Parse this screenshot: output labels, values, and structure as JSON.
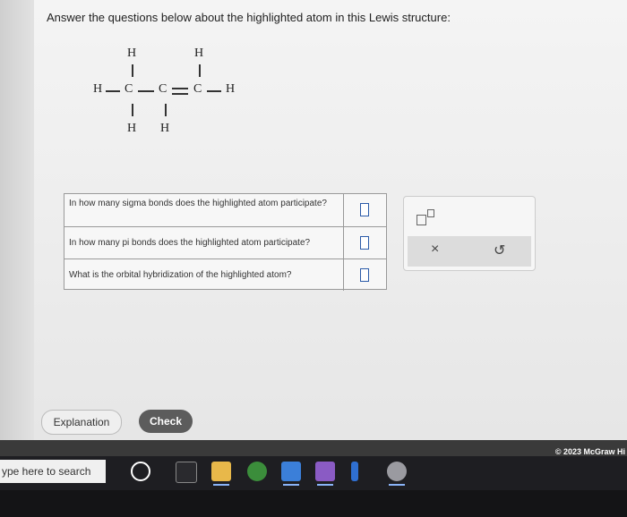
{
  "question": {
    "prompt": "Answer the questions below about the highlighted atom in this Lewis structure:"
  },
  "lewis_structure": {
    "atoms": [
      "H",
      "H",
      "H",
      "C",
      "C",
      "C",
      "H",
      "H",
      "H"
    ]
  },
  "questions": [
    {
      "text": "In how many sigma bonds does the highlighted atom participate?",
      "answer": ""
    },
    {
      "text": "In how many pi bonds does the highlighted atom participate?",
      "answer": ""
    },
    {
      "text": "What is the orbital hybridization of the highlighted atom?",
      "answer": ""
    }
  ],
  "toolbar": {
    "superscript_icon": "superscript-icon",
    "clear_icon": "×",
    "undo_icon": "↺"
  },
  "buttons": {
    "explanation": "Explanation",
    "check": "Check"
  },
  "footer": {
    "copyright": "© 2023 McGraw Hi"
  },
  "taskbar": {
    "search_placeholder": "ype here to search"
  }
}
